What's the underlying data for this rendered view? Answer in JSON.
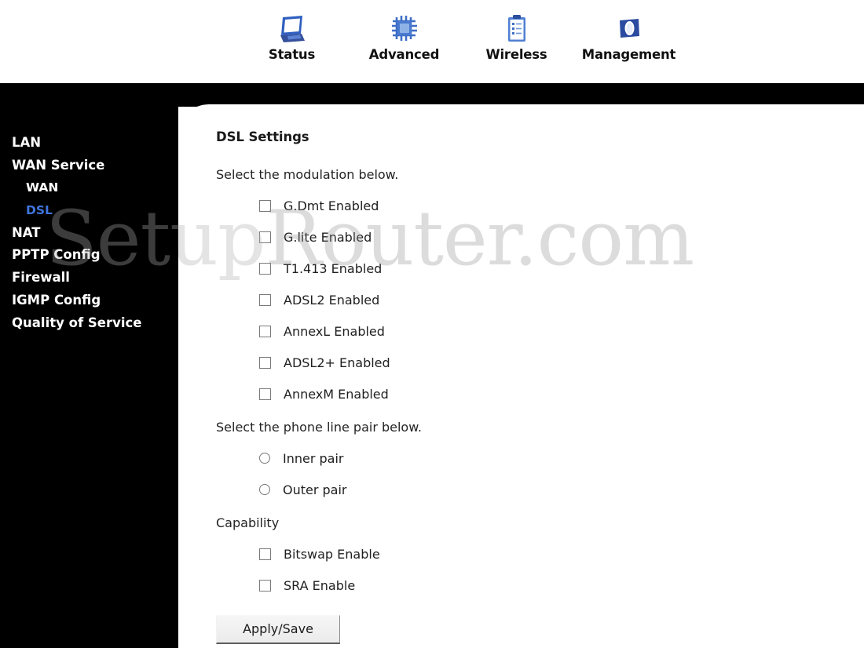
{
  "header": {
    "nav": [
      {
        "label": "Status",
        "icon": "monitor-icon"
      },
      {
        "label": "Advanced",
        "icon": "chip-icon"
      },
      {
        "label": "Wireless",
        "icon": "clipboard-icon"
      },
      {
        "label": "Management",
        "icon": "folder-icon"
      }
    ]
  },
  "sidebar": {
    "items": [
      {
        "label": "LAN",
        "level": 0,
        "active": false
      },
      {
        "label": "WAN Service",
        "level": 0,
        "active": false
      },
      {
        "label": "WAN",
        "level": 1,
        "active": false
      },
      {
        "label": "DSL",
        "level": 1,
        "active": true
      },
      {
        "label": "NAT",
        "level": 0,
        "active": false
      },
      {
        "label": "PPTP Config",
        "level": 0,
        "active": false
      },
      {
        "label": "Firewall",
        "level": 0,
        "active": false
      },
      {
        "label": "IGMP Config",
        "level": 0,
        "active": false
      },
      {
        "label": "Quality of Service",
        "level": 0,
        "active": false
      }
    ],
    "active_color": "#3f74dc"
  },
  "main": {
    "title": "DSL Settings",
    "modulation": {
      "label": "Select the modulation below.",
      "options": [
        {
          "label": "G.Dmt Enabled",
          "checked": false
        },
        {
          "label": "G.lite Enabled",
          "checked": false
        },
        {
          "label": "T1.413 Enabled",
          "checked": false
        },
        {
          "label": "ADSL2 Enabled",
          "checked": false
        },
        {
          "label": "AnnexL Enabled",
          "checked": false
        },
        {
          "label": "ADSL2+ Enabled",
          "checked": false
        },
        {
          "label": "AnnexM Enabled",
          "checked": false
        }
      ]
    },
    "phone_line_pair": {
      "label": "Select the phone line pair below.",
      "options": [
        {
          "label": "Inner pair",
          "selected": false
        },
        {
          "label": "Outer pair",
          "selected": false
        }
      ]
    },
    "capability": {
      "label": "Capability",
      "options": [
        {
          "label": "Bitswap Enable",
          "checked": false
        },
        {
          "label": "SRA Enable",
          "checked": false
        }
      ]
    },
    "apply_button": "Apply/Save"
  },
  "watermark": {
    "text_part1": "Setup",
    "text_part2": "Router.com"
  }
}
